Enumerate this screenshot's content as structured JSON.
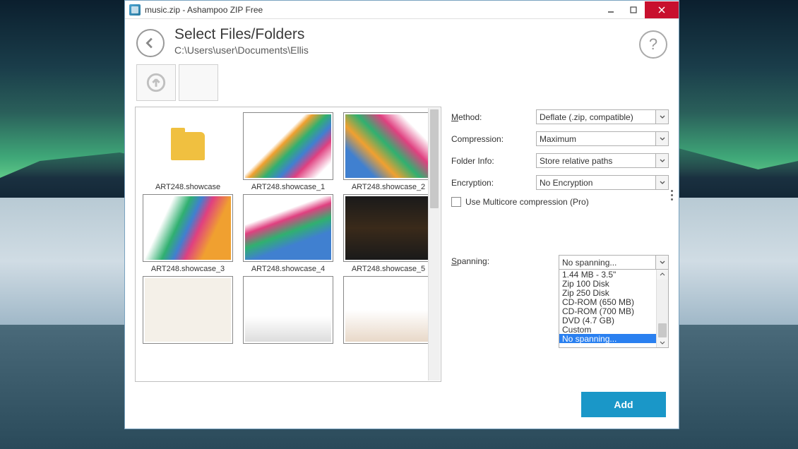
{
  "window": {
    "title": "music.zip - Ashampoo ZIP Free"
  },
  "header": {
    "title": "Select Files/Folders",
    "path": "C:\\Users\\user\\Documents\\Ellis"
  },
  "files": [
    {
      "name": "ART248.showcase",
      "kind": "folder"
    },
    {
      "name": "ART248.showcase_1",
      "kind": "image",
      "cls": "tg1"
    },
    {
      "name": "ART248.showcase_2",
      "kind": "image",
      "cls": "tg2"
    },
    {
      "name": "ART248.showcase_3",
      "kind": "image",
      "cls": "tg3"
    },
    {
      "name": "ART248.showcase_4",
      "kind": "image",
      "cls": "tg4"
    },
    {
      "name": "ART248.showcase_5",
      "kind": "image",
      "cls": "tg5"
    },
    {
      "name": "",
      "kind": "image",
      "cls": "tg6"
    },
    {
      "name": "",
      "kind": "image",
      "cls": "tg7"
    },
    {
      "name": "",
      "kind": "image",
      "cls": "tg8"
    }
  ],
  "options": {
    "method": {
      "label": "Method:",
      "hot": "M",
      "value": "Deflate (.zip, compatible)"
    },
    "compression": {
      "label": "Compression:",
      "hot": "",
      "value": "Maximum"
    },
    "folder_info": {
      "label": "Folder Info:",
      "hot": "",
      "value": "Store relative paths"
    },
    "encryption": {
      "label": "Encryption:",
      "hot": "",
      "value": "No Encryption"
    },
    "multicore": {
      "label": "Use Multicore compression (Pro)",
      "checked": false
    }
  },
  "spanning": {
    "label": "Spanning:",
    "hot": "S",
    "value": "No spanning...",
    "options": [
      "1.44 MB - 3.5\"",
      "Zip 100 Disk",
      "Zip 250 Disk",
      "CD-ROM (650 MB)",
      "CD-ROM (700 MB)",
      "DVD (4.7 GB)",
      "Custom",
      "No spanning..."
    ],
    "selected_index": 7
  },
  "footer": {
    "add": "Add",
    "hot": "A"
  }
}
